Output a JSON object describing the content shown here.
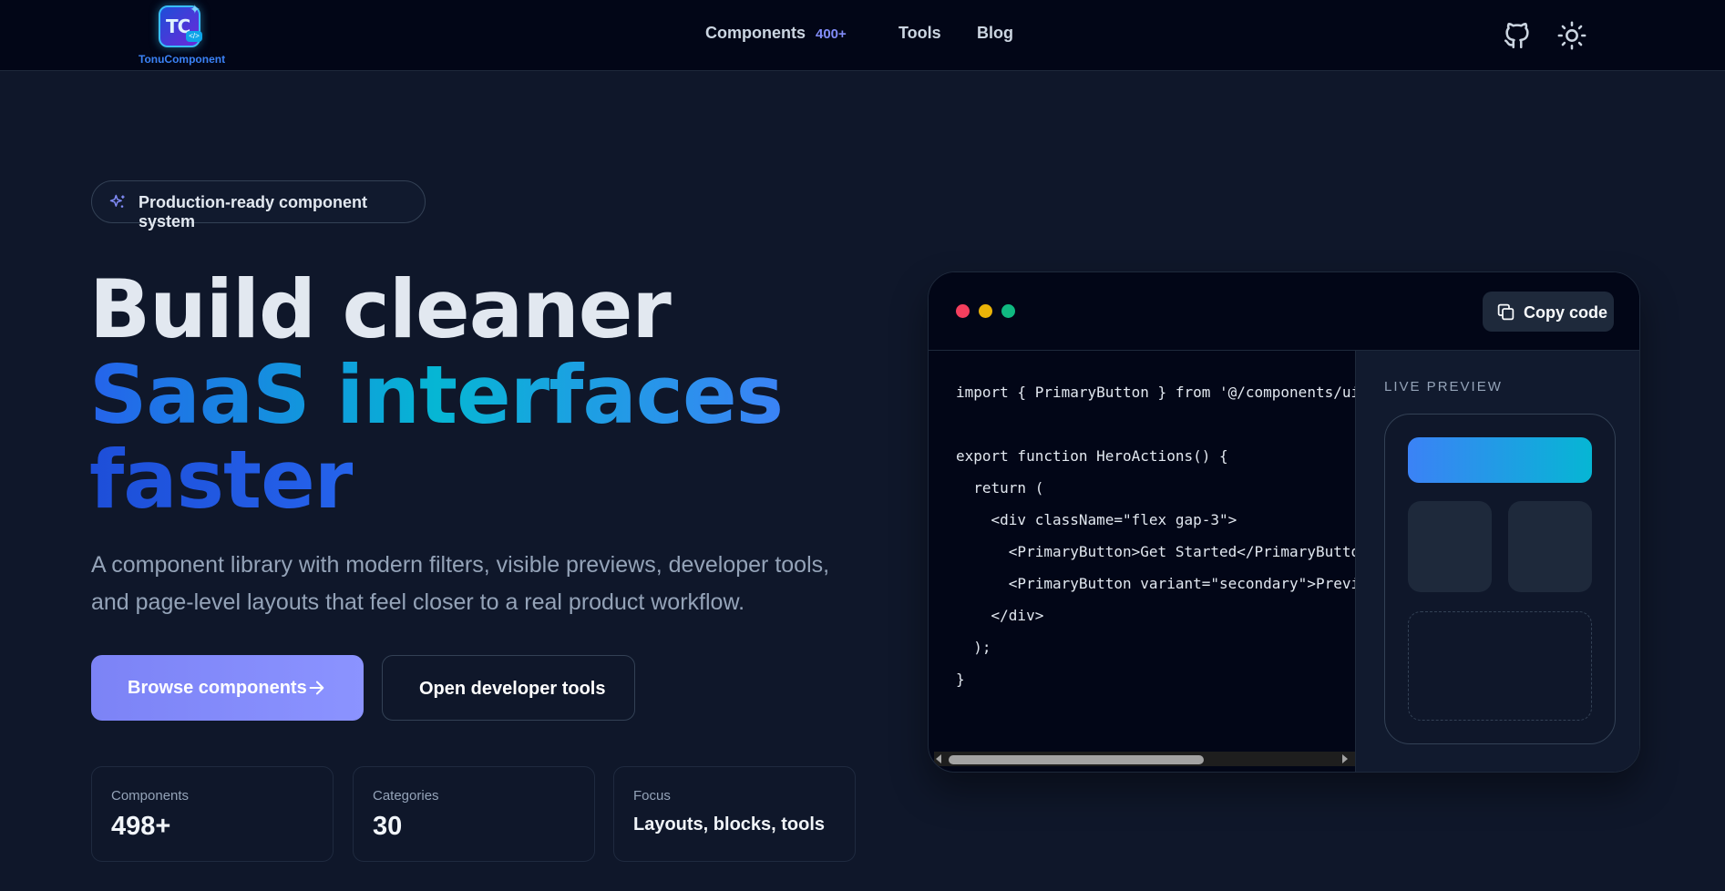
{
  "nav": {
    "logo_text": "TonuComponent",
    "logo_mark": "TC",
    "links": [
      {
        "label": "Components",
        "badge": "400+"
      },
      {
        "label": "Tools"
      },
      {
        "label": "Blog"
      }
    ],
    "icons": [
      "github-icon",
      "sun-icon"
    ]
  },
  "hero": {
    "pill": "Production-ready component system",
    "title_line1": "Build cleaner",
    "title_line2": "SaaS interfaces",
    "title_line3": "faster",
    "lead": "A component library with modern filters, visible previews, developer tools, and page-level layouts that feel closer to a real product workflow.",
    "primary_button": "Browse components",
    "secondary_button": "Open developer tools",
    "stats": [
      {
        "label": "Components",
        "value": "498+"
      },
      {
        "label": "Categories",
        "value": "30"
      },
      {
        "label": "Focus",
        "value": "Layouts, blocks, tools"
      }
    ]
  },
  "code_window": {
    "copy_button": "Copy code",
    "code_lines": [
      "import { PrimaryButton } from '@/components/ui",
      "",
      "export function HeroActions() {",
      "  return (",
      "    <div className=\"flex gap-3\">",
      "      <PrimaryButton>Get Started</PrimaryButto",
      "      <PrimaryButton variant=\"secondary\">Previ",
      "    </div>",
      "  );",
      "}"
    ],
    "preview_label": "LIVE PREVIEW"
  },
  "colors": {
    "background": "#0f172a",
    "nav_background": "#020617",
    "accent": "#818cf8",
    "gradient_start": "#2563eb",
    "gradient_end": "#06b6d4",
    "dot_red": "#f43f5e",
    "dot_yellow": "#eab308",
    "dot_green": "#10b981"
  }
}
